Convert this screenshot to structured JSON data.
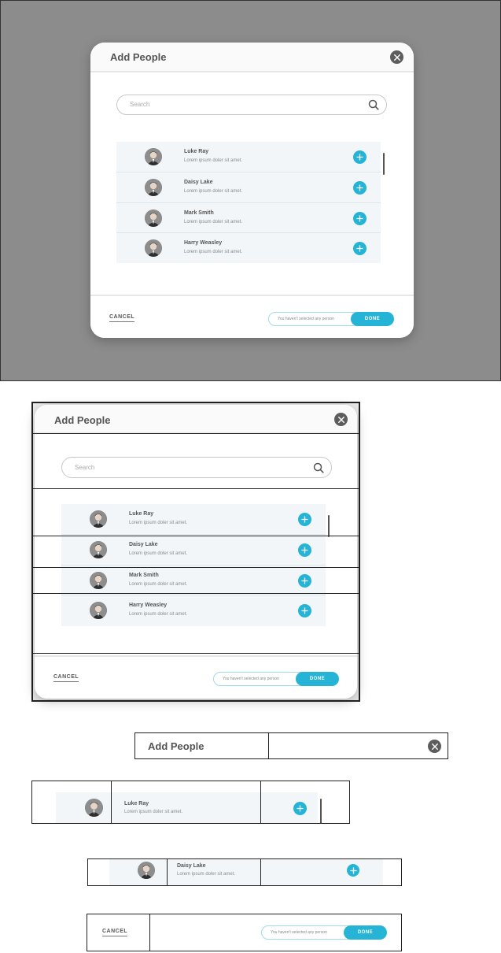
{
  "modal": {
    "title": "Add People",
    "search_placeholder": "Search",
    "people": [
      {
        "name": "Luke Ray",
        "desc": "Lorem ipsum doler sit amet."
      },
      {
        "name": "Daisy Lake",
        "desc": "Lorem ipsum doler sit amet."
      },
      {
        "name": "Mark Smith",
        "desc": "Lorem ipsum doler sit amet."
      },
      {
        "name": "Harry Weasley",
        "desc": "Lorem ipsum doler sit amet."
      }
    ],
    "cancel_label": "CANCEL",
    "selection_status": "You haven't selected any person",
    "done_label": "DONE"
  },
  "icons": {
    "close": "close-icon",
    "search": "search-icon",
    "add": "plus-icon",
    "avatar": "avatar-photo"
  },
  "colors": {
    "accent": "#26b4d6",
    "overlay": "#8c8c8c",
    "close_button": "#5d5d5d",
    "list_background": "#f2f6f9"
  }
}
